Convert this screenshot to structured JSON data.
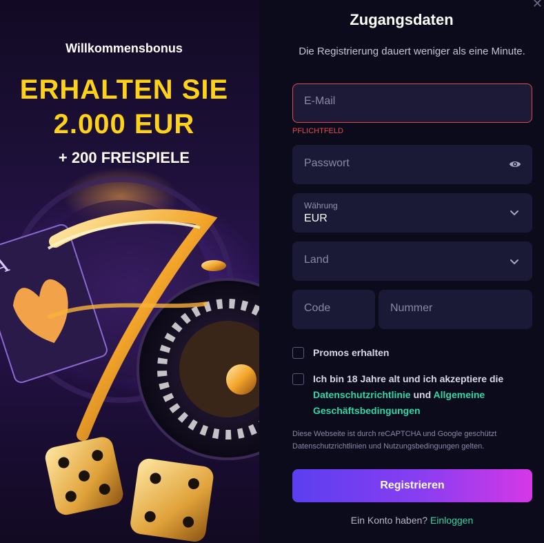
{
  "promo": {
    "bonus_label": "Willkommensbonus",
    "amount_line1": "ERHALTEN SIE",
    "amount_line2": "2.000 EUR",
    "free_spins": "+ 200 FREISPIELE"
  },
  "form": {
    "title": "Zugangsdaten",
    "subtitle": "Die Registrierung dauert weniger als eine Minute.",
    "email_placeholder": "E-Mail",
    "email_error": "PFLICHTFELD",
    "password_placeholder": "Passwort",
    "currency_label": "Währung",
    "currency_value": "EUR",
    "country_placeholder": "Land",
    "code_placeholder": "Code",
    "number_placeholder": "Nummer",
    "promos_label": "Promos erhalten",
    "terms_prefix": "Ich bin 18 Jahre alt und ich akzeptiere die",
    "privacy_link": "Datenschutzrichtlinie",
    "terms_and": "und",
    "terms_link_part1": "Allgemeine",
    "terms_link_part2": "Geschäftsbedingungen",
    "recaptcha_line1": "Diese Webseite ist durch reCAPTCHA und Google geschützt",
    "recaptcha_line2": "Datenschutzrichtlinien und Nutzungsbedingungen gelten.",
    "register_button": "Registrieren",
    "have_account": "Ein Konto haben?",
    "login_link": "Einloggen"
  },
  "icons": {
    "close": "close-icon",
    "eye": "eye-icon",
    "chevron": "chevron-down-icon"
  },
  "colors": {
    "accent_yellow": "#ffd21a",
    "link_green": "#2fd8a6",
    "error_red": "#e5484d",
    "button_gradient_start": "#5b3ff0",
    "button_gradient_end": "#d638e6"
  }
}
